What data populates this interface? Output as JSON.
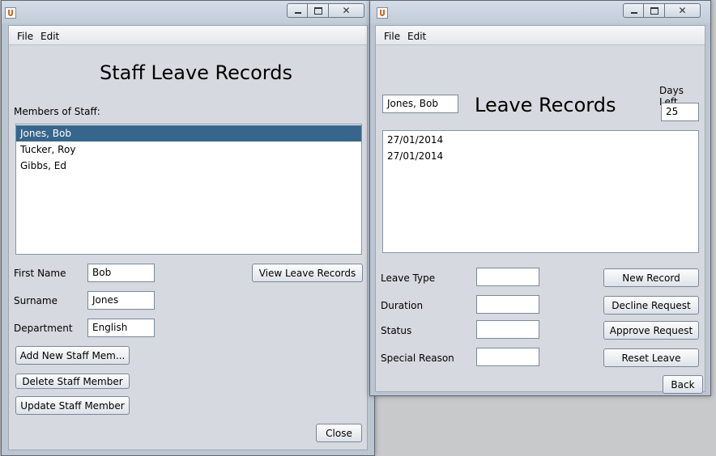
{
  "staff_window": {
    "menu": [
      "File",
      "Edit"
    ],
    "heading": "Staff Leave Records",
    "members_label": "Members of Staff:",
    "members": [
      {
        "name": "Jones, Bob",
        "selected": true
      },
      {
        "name": "Tucker, Roy",
        "selected": false
      },
      {
        "name": "Gibbs, Ed",
        "selected": false
      }
    ],
    "first_name_label": "First Name",
    "first_name_value": "Bob",
    "surname_label": "Surname",
    "surname_value": "Jones",
    "department_label": "Department",
    "department_value": "English",
    "view_leave_button": "View Leave Records",
    "add_button": "Add New Staff Mem...",
    "delete_button": "Delete Staff Member",
    "update_button": "Update Staff Member",
    "close_button": "Close"
  },
  "leave_window": {
    "menu": [
      "File",
      "Edit"
    ],
    "staff_name": "Jones, Bob",
    "heading": "Leave Records",
    "days_left_label": "Days Left",
    "days_left_value": "25",
    "records": [
      "27/01/2014",
      "27/01/2014"
    ],
    "leave_type_label": "Leave Type",
    "leave_type_value": "",
    "duration_label": "Duration",
    "duration_value": "",
    "status_label": "Status",
    "status_value": "",
    "special_reason_label": "Special Reason",
    "special_reason_value": "",
    "new_record_button": "New Record",
    "decline_button": "Decline Request",
    "approve_button": "Approve Request",
    "reset_button": "Reset Leave",
    "back_button": "Back"
  },
  "colors": {
    "selection": "#37668c",
    "window_frame": "#bcc6d2",
    "client_bg": "#d6d9df"
  }
}
